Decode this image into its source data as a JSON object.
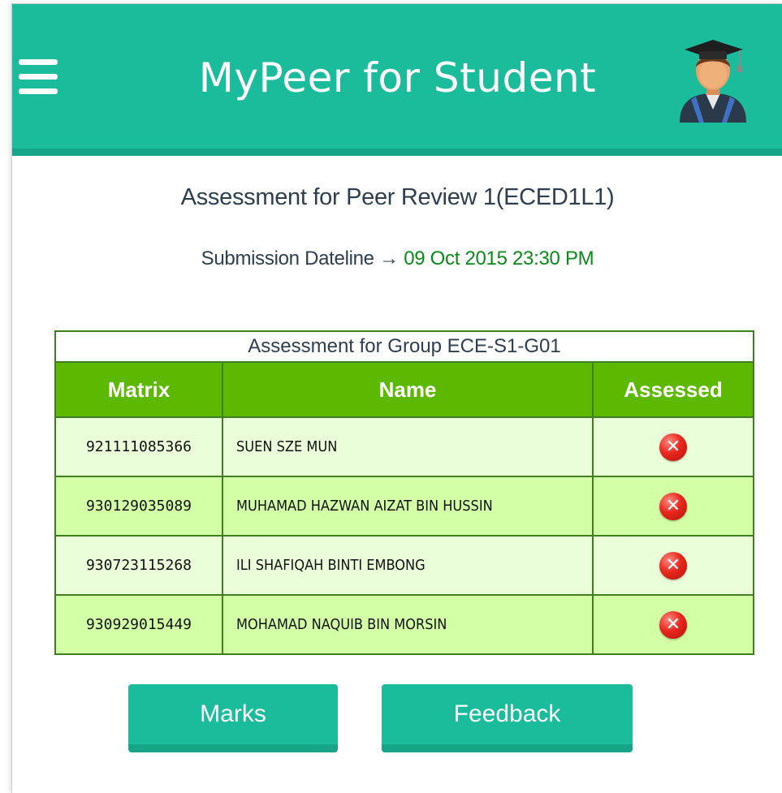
{
  "header": {
    "title": "MyPeer for Student",
    "menu_icon": "hamburger-menu-icon",
    "avatar_icon": "graduate-student-avatar-icon",
    "color": "#1abc9c"
  },
  "assessment": {
    "heading": "Assessment for Peer Review 1(ECED1L1)",
    "deadline_label": "Submission Dateline",
    "deadline_arrow": "→",
    "deadline_value": "09 Oct 2015 23:30 PM",
    "deadline_color": "#0a8a1a"
  },
  "table": {
    "caption": "Assessment for Group ECE-S1-G01",
    "columns": [
      "Matrix",
      "Name",
      "Assessed"
    ],
    "header_color": "#5cb900",
    "rows": [
      {
        "matrix": "921111085366",
        "name": "SUEN SZE MUN",
        "assessed": "not-assessed-icon"
      },
      {
        "matrix": "930129035089",
        "name": "MUHAMAD HAZWAN AIZAT BIN HUSSIN",
        "assessed": "not-assessed-icon"
      },
      {
        "matrix": "930723115268",
        "name": "ILI SHAFIQAH BINTI EMBONG",
        "assessed": "not-assessed-icon"
      },
      {
        "matrix": "930929015449",
        "name": "MOHAMAD NAQUIB BIN MORSIN",
        "assessed": "not-assessed-icon"
      }
    ]
  },
  "buttons": {
    "marks": "Marks",
    "feedback": "Feedback"
  }
}
